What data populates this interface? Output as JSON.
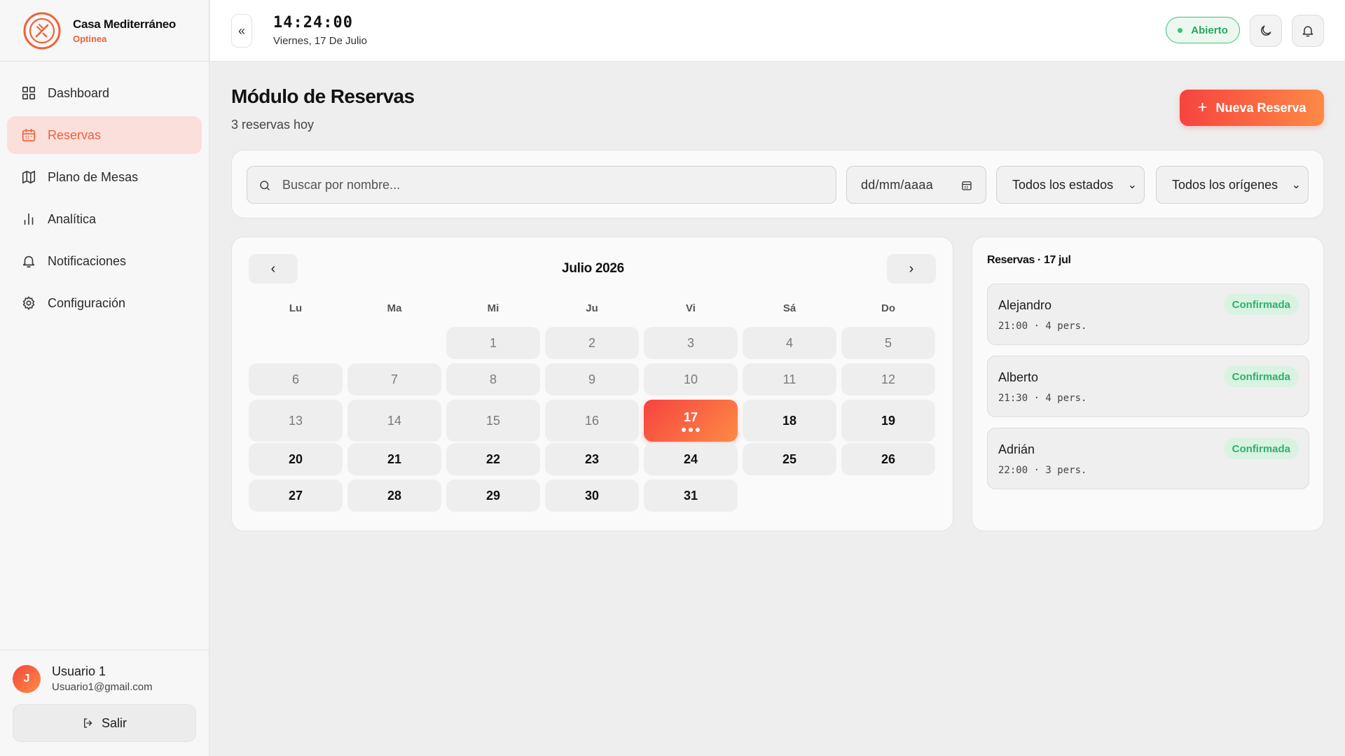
{
  "brand": {
    "name": "Casa Mediterráneo",
    "subtitle": "Optinea",
    "accent": "#f0613a"
  },
  "sidebar": {
    "items": [
      {
        "label": "Dashboard",
        "icon": "grid-icon",
        "active": false
      },
      {
        "label": "Reservas",
        "icon": "calendar-icon",
        "active": true
      },
      {
        "label": "Plano de Mesas",
        "icon": "map-icon",
        "active": false
      },
      {
        "label": "Analítica",
        "icon": "bar-chart-icon",
        "active": false
      },
      {
        "label": "Notificaciones",
        "icon": "bell-icon",
        "active": false
      },
      {
        "label": "Configuración",
        "icon": "gear-icon",
        "active": false
      }
    ]
  },
  "user": {
    "initial": "J",
    "name": "Usuario 1",
    "email": "Usuario1@gmail.com",
    "logout_label": "Salir"
  },
  "topbar": {
    "collapse_glyph": "«",
    "time": "14:24:00",
    "date": "Viernes, 17 De Julio",
    "status": "Abierto",
    "status_color": "#3cc27a"
  },
  "page": {
    "title": "Módulo de Reservas",
    "subtitle": "3 reservas hoy",
    "new_button_label": "Nueva Reserva"
  },
  "filters": {
    "search_placeholder": "Buscar por nombre...",
    "date_placeholder": "dd/mm/aaaa",
    "status_select": "Todos los estados",
    "origin_select": "Todos los orígenes"
  },
  "calendar": {
    "month_label": "Julio 2026",
    "prev_glyph": "‹",
    "next_glyph": "›",
    "weekdays": [
      "Lu",
      "Ma",
      "Mi",
      "Ju",
      "Vi",
      "Sá",
      "Do"
    ],
    "first_weekday_index": 2,
    "days_in_month": 31,
    "today": 17,
    "today_reservation_dots": 3
  },
  "reservations_panel": {
    "title": "Reservas · 17 jul",
    "items": [
      {
        "name": "Alejandro",
        "meta": "21:00 · 4 pers.",
        "status": "Confirmada"
      },
      {
        "name": "Alberto",
        "meta": "21:30 · 4 pers.",
        "status": "Confirmada"
      },
      {
        "name": "Adrián",
        "meta": "22:00 · 3 pers.",
        "status": "Confirmada"
      }
    ]
  }
}
